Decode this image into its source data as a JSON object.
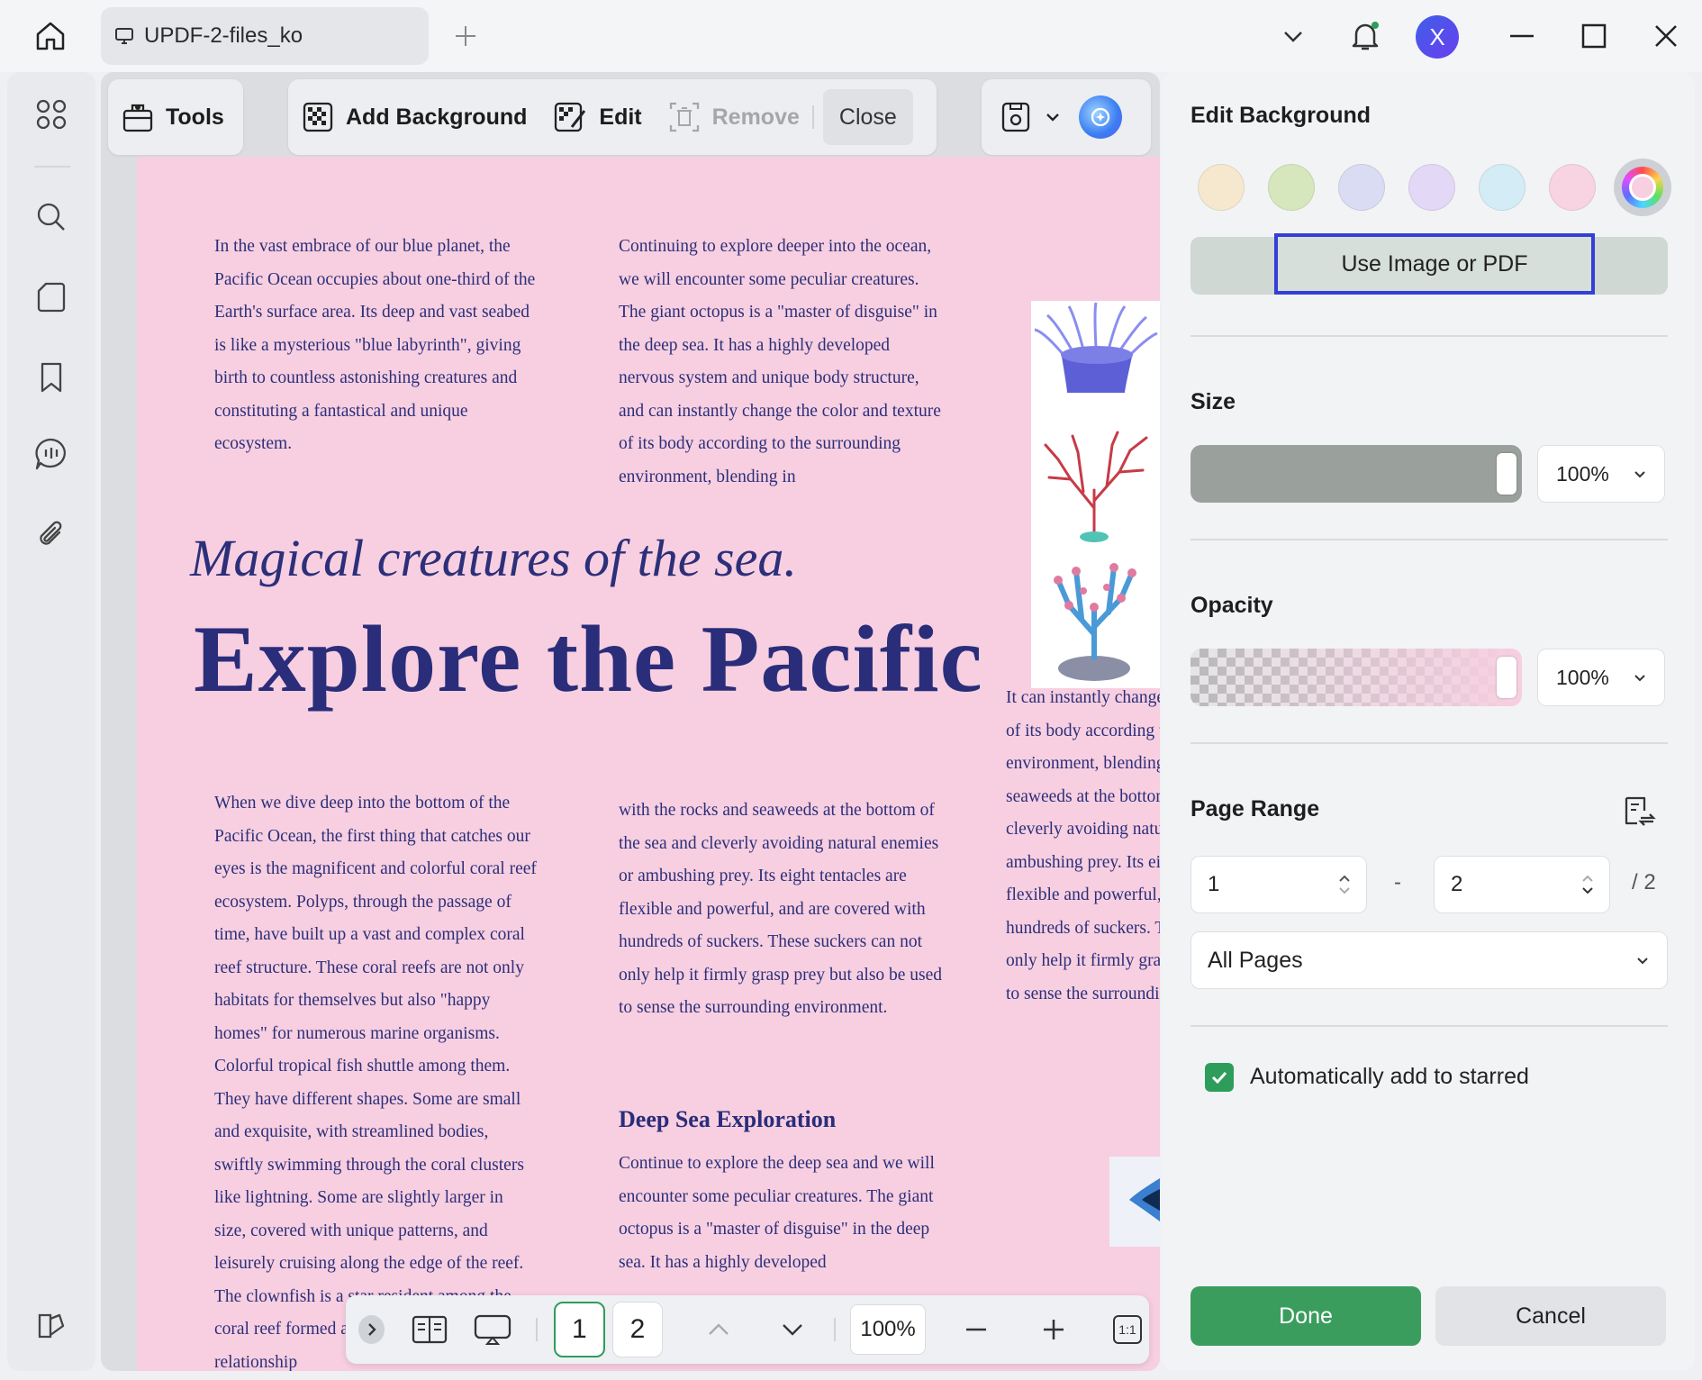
{
  "titlebar": {
    "tab_title": "UPDF-2-files_ko",
    "avatar_letter": "X"
  },
  "toolbar": {
    "tools_label": "Tools",
    "add_background_label": "Add Background",
    "edit_label": "Edit",
    "remove_label": "Remove",
    "close_label": "Close"
  },
  "document": {
    "col1_para1": "In the vast embrace of our blue planet, the Pacific Ocean occupies about one-third of the Earth's surface area. Its deep and vast seabed is like a mysterious \"blue labyrinth\", giving birth to countless astonishing creatures and constituting a fantastical and unique ecosystem.",
    "col2_para1": "Continuing to explore deeper into the ocean, we will encounter some peculiar creatures. The giant octopus is a \"master of disguise\" in the deep sea. It has a highly developed nervous system and unique body structure, and can instantly change the color and texture of its body according to the surrounding environment, blending in",
    "subtitle": "Magical creatures of the sea.",
    "title": "Explore the Pacific",
    "col1_para2": "When we dive deep into the bottom of the Pacific Ocean, the first thing that catches our eyes is the magnificent and colorful coral reef ecosystem. Polyps, through the passage of time, have built up a vast and complex coral reef structure. These coral reefs are not only habitats for themselves but also \"happy homes\" for numerous marine organisms. Colorful tropical fish shuttle among them. They have different shapes. Some are small and exquisite, with streamlined bodies, swiftly swimming through the coral clusters like lightning. Some are slightly larger in size, covered with unique patterns, and leisurely cruising along the edge of the reef. The clownfish is a star resident among the coral reef formed a wonderful symbiotic relationship",
    "col2_para2": "with the rocks and seaweeds at the bottom of the sea and cleverly avoiding natural enemies or ambushing prey. Its eight tentacles are flexible and powerful, and are covered with hundreds of suckers. These suckers can not only help it firmly grasp prey but also be used to sense the surrounding environment.",
    "heading_deep_sea": "Deep Sea Exploration",
    "col2_para3": "Continue to explore the deep sea and we will encounter some peculiar creatures. The giant octopus is a \"master of disguise\" in the deep sea. It has a highly developed",
    "col3_para": "It can instantly change the color and texture of its body according to the surrounding environment, blending in with the rocks and seaweeds at the bottom of the sea and cleverly avoiding natural enemies or ambushing prey. Its eight tentacles are flexible and powerful, and are covered with hundreds of suckers. These suckers can not only help it firmly grasp prey but also be used to sense the surrounding environment."
  },
  "bottom_nav": {
    "page_1": "1",
    "page_2": "2",
    "zoom": "100%",
    "actual_size": "1:1"
  },
  "panel": {
    "title": "Edit Background",
    "swatches": [
      "#f6e7cf",
      "#d6e6bd",
      "#d9dcf2",
      "#e3d8f6",
      "#d3ecf6",
      "#f8d4e2"
    ],
    "use_image_label": "Use Image or PDF",
    "size_label": "Size",
    "size_value": "100%",
    "opacity_label": "Opacity",
    "opacity_value": "100%",
    "page_range_label": "Page Range",
    "range_from": "1",
    "range_dash": "-",
    "range_to": "2",
    "range_total": "/ 2",
    "range_select": "All Pages",
    "auto_star_label": "Automatically add to starred",
    "done_label": "Done",
    "cancel_label": "Cancel"
  },
  "colors": {
    "page_background": "#f7cfe0",
    "text_navy": "#2c2f7a",
    "done_green": "#3a9d5e",
    "focus_blue": "#3340d6"
  }
}
